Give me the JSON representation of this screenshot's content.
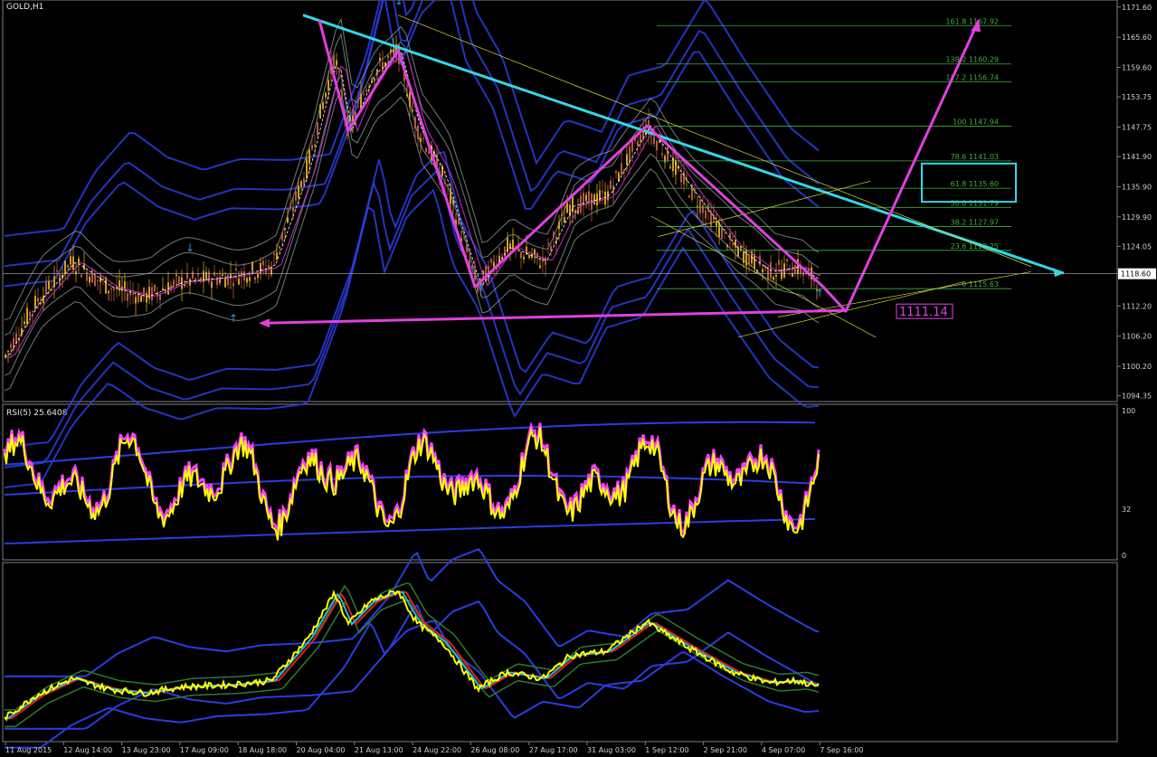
{
  "window": {
    "title": "GOLD,H1"
  },
  "main_panel": {
    "price_labels": [
      "1171.60",
      "1165.60",
      "1159.60",
      "1153.75",
      "1147.75",
      "1141.90",
      "1135.90",
      "1129.90",
      "1124.05",
      "1118.60",
      "1112.20",
      "1106.20",
      "1100.20",
      "1094.35"
    ],
    "current_price": "1118.60",
    "target_label": "1111.14"
  },
  "fib_levels": [
    {
      "label": "161.8 1167.92",
      "value": 1167.92
    },
    {
      "label": "138.2 1160.29",
      "value": 1160.29
    },
    {
      "label": "127.2 1156.74",
      "value": 1156.74
    },
    {
      "label": "100 1147.94",
      "value": 1147.94
    },
    {
      "label": "78.6 1141.03",
      "value": 1141.03
    },
    {
      "label": "61.8 1135.60",
      "value": 1135.6
    },
    {
      "label": "50.0 1131.79",
      "value": 1131.79
    },
    {
      "label": "38.2 1127.97",
      "value": 1127.97
    },
    {
      "label": "23.6 1123.25",
      "value": 1123.25
    },
    {
      "label": "0 1115.63",
      "value": 1115.63
    }
  ],
  "time_labels": [
    "11 Aug 2015",
    "12 Aug 14:00",
    "13 Aug 23:00",
    "17 Aug 09:00",
    "18 Aug 18:00",
    "20 Aug 04:00",
    "21 Aug 13:00",
    "24 Aug 22:00",
    "26 Aug 08:00",
    "27 Aug 17:00",
    "31 Aug 03:00",
    "1 Sep 12:00",
    "2 Sep 21:00",
    "4 Sep 07:00",
    "7 Sep 16:00"
  ],
  "rsi_panel": {
    "title": "RSI(5) 25.6408",
    "scale_labels": [
      "100",
      "32",
      "0"
    ]
  },
  "colors": {
    "background": "#000000",
    "candle_up": "#d4a020",
    "candle_down": "#b05a40",
    "band_blue": "#2a3de0",
    "band_gray": "#8a9a9a",
    "pattern": "#e040e0",
    "trendline": "#30d8e8",
    "fib": "#3fae3f",
    "rsi_yellow": "#ffff00",
    "rsi_magenta": "#ff40ff"
  },
  "chart_data": [
    {
      "type": "line",
      "title": "GOLD,H1",
      "x": [
        "11 Aug 2015",
        "12 Aug 14:00",
        "13 Aug 23:00",
        "17 Aug 09:00",
        "18 Aug 18:00",
        "20 Aug 04:00",
        "21 Aug 13:00",
        "24 Aug 22:00",
        "26 Aug 08:00",
        "27 Aug 17:00",
        "31 Aug 03:00",
        "1 Sep 12:00",
        "2 Sep 21:00",
        "4 Sep 07:00",
        "7 Sep 16:00"
      ],
      "series": [
        {
          "values": [
            1100,
            1116,
            1114,
            1117,
            1117,
            1140,
            1162,
            1146,
            1119,
            1129,
            1138,
            1146,
            1132,
            1121,
            1118
          ]
        }
      ],
      "ylim": [
        1094.35,
        1173
      ],
      "grid": false
    },
    {
      "type": "line",
      "title": "RSI(5) 25.6408",
      "ylim": [
        0,
        100
      ],
      "series": [
        {
          "values": [
            50,
            75,
            40,
            55,
            45,
            80,
            70,
            30,
            60,
            35,
            55,
            40,
            70,
            45,
            25
          ]
        }
      ]
    }
  ]
}
